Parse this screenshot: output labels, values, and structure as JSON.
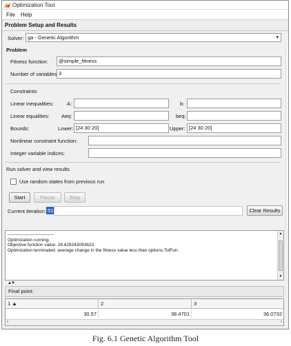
{
  "window": {
    "title": "Optimization Tool"
  },
  "menu": [
    "File",
    "Help"
  ],
  "panel_title": "Problem Setup and Results",
  "solver": {
    "label": "Solver:",
    "value": "ga - Genetic Algorithm"
  },
  "problem": {
    "heading": "Problem",
    "fitness_label": "Fitness function:",
    "fitness_value": "@simple_fitness",
    "numvars_label": "Number of variables:",
    "numvars_value": "3"
  },
  "constraints": {
    "heading": "Constraints:",
    "linear_ineq_label": "Linear inequalities:",
    "A_label": "A:",
    "b_label": "b:",
    "linear_eq_label": "Linear equalities:",
    "Aeq_label": "Aeq:",
    "beq_label": "beq:",
    "bounds_label": "Bounds:",
    "lower_label": "Lower:",
    "lower_value": "[24 30 20]",
    "upper_label": "Upper:",
    "upper_value": "[24 30 20]",
    "nonlinear_label": "Nonlinear constraint function:",
    "integer_label": "Integer variable indices:"
  },
  "run": {
    "heading": "Run solver and view results",
    "random_states_label": "Use random states from previous run",
    "start_label": "Start",
    "pause_label": "Pause",
    "stop_label": "Stop",
    "iteration_label": "Current iteration:",
    "iteration_value": "51",
    "clear_label": "Clear Results"
  },
  "output": {
    "lines": [
      "-------------------------------",
      "Optimization running.",
      "Objective function value:    28.428243093623",
      "Optimization terminated: average change in the fitness value less than options.TolFun."
    ]
  },
  "final_point": {
    "heading": "Final point:",
    "columns": [
      "1 ▲",
      "2",
      "3"
    ],
    "values": [
      "30.57",
      "38.4701",
      "36.0732"
    ]
  },
  "caption": "Fig. 6.1 Genetic Algorithm Tool"
}
